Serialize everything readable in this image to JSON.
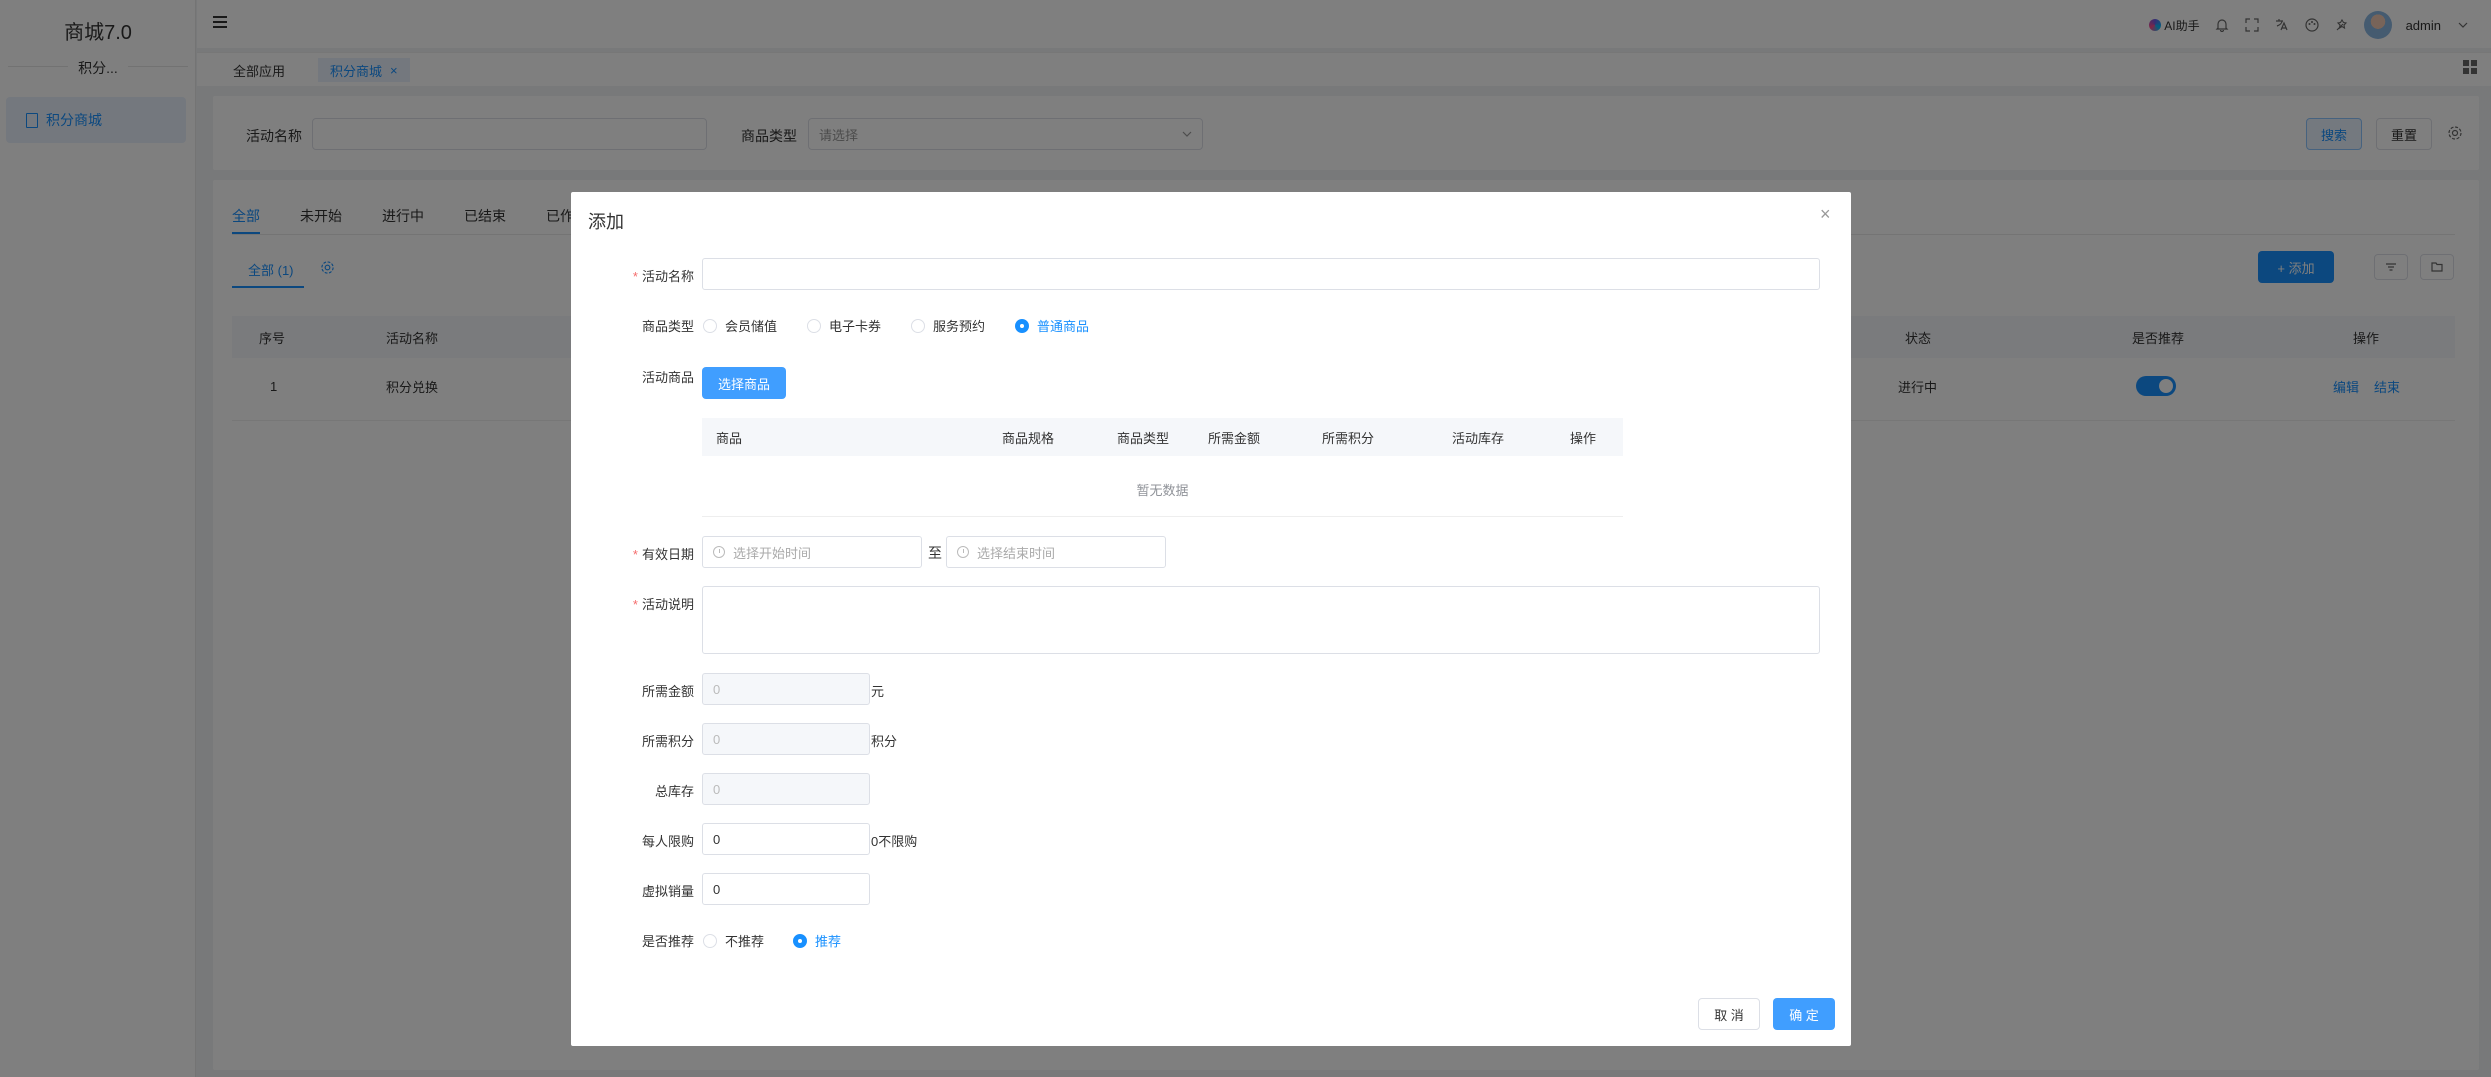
{
  "sidebar": {
    "brand": "商城7.0",
    "sub_brand": "积分...",
    "items": [
      {
        "label": "积分商城",
        "icon": "document-icon"
      }
    ]
  },
  "header": {
    "ai_label": "AI助手",
    "user": "admin",
    "icons": [
      "bell-icon",
      "fullscreen-icon",
      "translate-icon",
      "palette-icon",
      "theme-icon"
    ]
  },
  "tabs": [
    {
      "label": "全部应用"
    },
    {
      "label": "积分商城",
      "active": true
    }
  ],
  "search": {
    "activity_name_label": "活动名称",
    "activity_name_value": "",
    "product_type_label": "商品类型",
    "product_type_placeholder": "请选择",
    "search_button": "搜索",
    "reset_button": "重置"
  },
  "status_tabs": [
    "全部",
    "未开始",
    "进行中",
    "已结束",
    "已作"
  ],
  "list": {
    "filter_tab": "全部 (1)",
    "add_button": "+ 添加",
    "columns": [
      "序号",
      "活动名称",
      "状态",
      "是否推荐",
      "操作"
    ],
    "rows": [
      {
        "index": "1",
        "name": "积分兑换",
        "status": "进行中",
        "recommend": true,
        "edit": "编辑",
        "end": "结束"
      }
    ]
  },
  "modal": {
    "title": "添加",
    "fields": {
      "activity_name": {
        "label": "活动名称",
        "value": ""
      },
      "product_type": {
        "label": "商品类型",
        "options": [
          "会员储值",
          "电子卡券",
          "服务预约",
          "普通商品"
        ],
        "selected": "普通商品"
      },
      "activity_product": {
        "label": "活动商品",
        "button": "选择商品",
        "columns": [
          "商品",
          "商品规格",
          "商品类型",
          "所需金额",
          "所需积分",
          "活动库存",
          "操作"
        ],
        "empty_text": "暂无数据"
      },
      "valid_date": {
        "label": "有效日期",
        "start_placeholder": "选择开始时间",
        "separator": "至",
        "end_placeholder": "选择结束时间"
      },
      "description": {
        "label": "活动说明",
        "value": ""
      },
      "required_amount": {
        "label": "所需金额",
        "value": "0",
        "unit": "元"
      },
      "required_points": {
        "label": "所需积分",
        "value": "0",
        "unit": "积分"
      },
      "total_stock": {
        "label": "总库存",
        "value": "0"
      },
      "per_person_limit": {
        "label": "每人限购",
        "value": "0",
        "hint": "0不限购"
      },
      "virtual_sales": {
        "label": "虚拟销量",
        "value": "0"
      },
      "is_recommend": {
        "label": "是否推荐",
        "options": [
          "不推荐",
          "推荐"
        ],
        "selected": "推荐"
      }
    },
    "cancel_button": "取 消",
    "confirm_button": "确 定"
  },
  "colors": {
    "primary": "#1890ff",
    "required": "#f56c6c",
    "overlay": "rgba(0,0,0,0.5)"
  }
}
